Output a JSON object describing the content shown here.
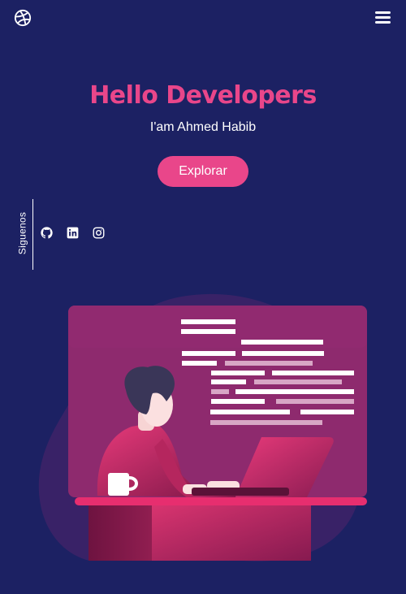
{
  "header": {
    "logo_icon": "dribbble-icon",
    "menu_icon": "hamburger-menu-icon"
  },
  "hero": {
    "title": "Hello Developers",
    "subtitle": "I'am Ahmed Habib",
    "cta_label": "Explorar"
  },
  "social": {
    "label": "Siguenos",
    "icons": [
      "github-icon",
      "linkedin-icon",
      "instagram-icon"
    ]
  },
  "colors": {
    "background": "#1c2163",
    "accent": "#e9468a",
    "panel": "#8e2a6e",
    "text": "#ffffff"
  }
}
